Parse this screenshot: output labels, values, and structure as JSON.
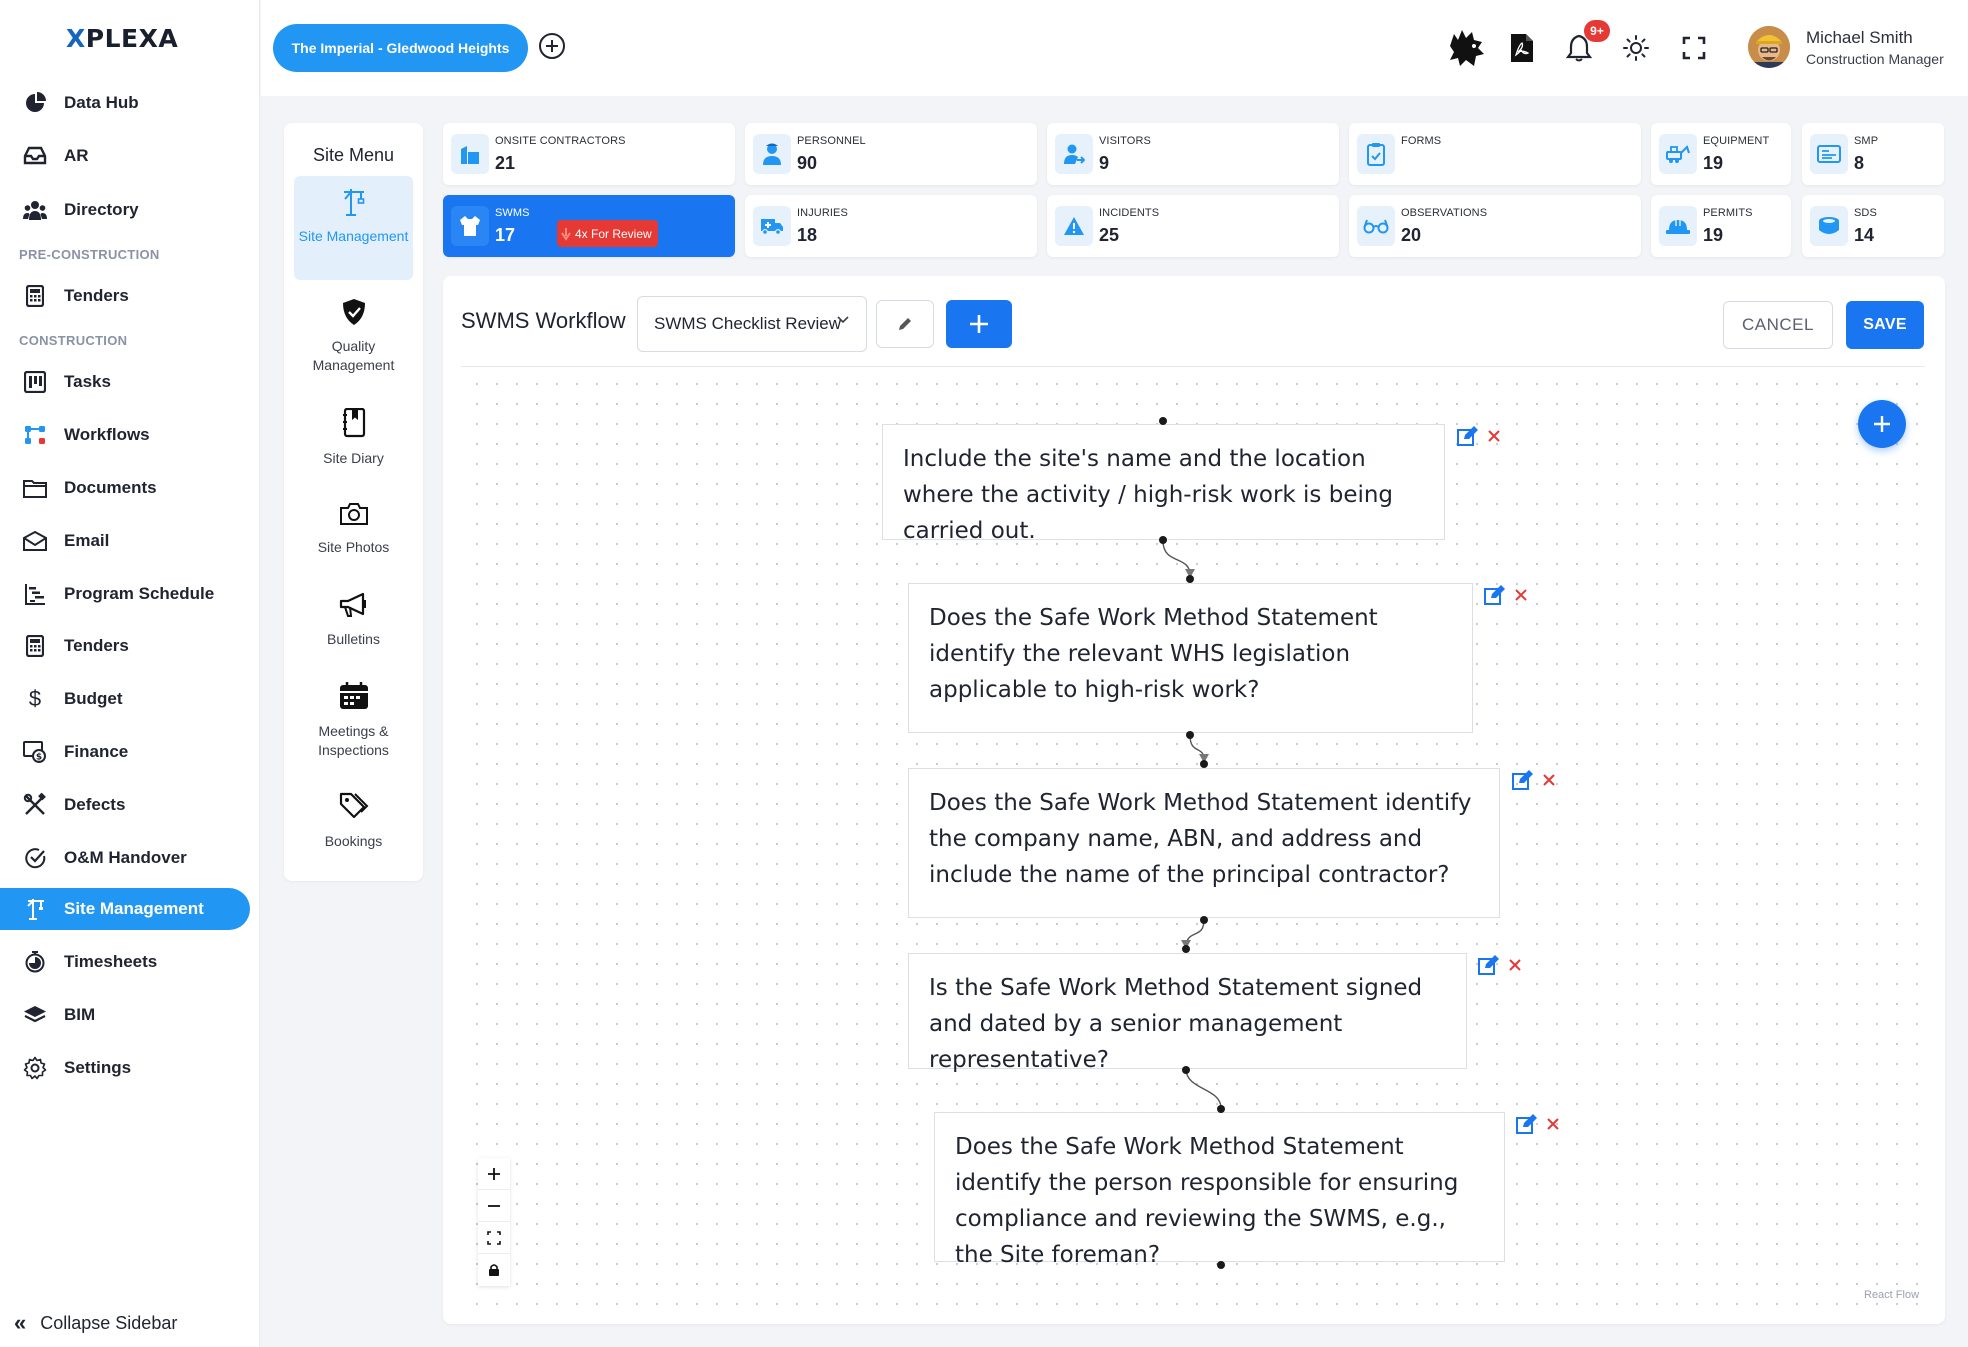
{
  "brand": {
    "logo_mark": "X",
    "logo_text": "PLEXA",
    "accent": "#2196f3",
    "primary": "#1976f0"
  },
  "sidebar": {
    "items_top": [
      {
        "label": "Data Hub",
        "icon": "pie-chart-icon"
      },
      {
        "label": "AR",
        "icon": "headset-icon"
      },
      {
        "label": "Directory",
        "icon": "people-icon"
      }
    ],
    "sections": {
      "pre_construction": "PRE-CONSTRUCTION",
      "construction": "CONSTRUCTION"
    },
    "pre_items": [
      {
        "label": "Tenders",
        "icon": "calculator-icon"
      }
    ],
    "items": [
      {
        "label": "Tasks",
        "icon": "kanban-icon"
      },
      {
        "label": "Workflows",
        "icon": "workflow-icon"
      },
      {
        "label": "Documents",
        "icon": "folder-icon"
      },
      {
        "label": "Email",
        "icon": "envelope-icon"
      },
      {
        "label": "Program Schedule",
        "icon": "gantt-icon"
      },
      {
        "label": "Tenders",
        "icon": "calculator-icon"
      },
      {
        "label": "Budget",
        "icon": "dollar-icon"
      },
      {
        "label": "Finance",
        "icon": "finance-icon"
      },
      {
        "label": "Defects",
        "icon": "tools-icon"
      },
      {
        "label": "O&M Handover",
        "icon": "check-circle-icon"
      },
      {
        "label": "Site Management",
        "icon": "crane-icon"
      },
      {
        "label": "Timesheets",
        "icon": "stopwatch-icon"
      },
      {
        "label": "BIM",
        "icon": "layers-icon"
      },
      {
        "label": "Settings",
        "icon": "gear-icon"
      }
    ],
    "collapse_label": "Collapse Sidebar"
  },
  "topbar": {
    "project": "The Imperial - Gledwood Heights",
    "notification_count": "9+",
    "user": {
      "name": "Michael Smith",
      "role": "Construction Manager"
    }
  },
  "site_menu": {
    "title": "Site Menu",
    "items": [
      {
        "label": "Site Management",
        "icon": "crane-icon"
      },
      {
        "label": "Quality Management",
        "icon": "shield-check-icon"
      },
      {
        "label": "Site Diary",
        "icon": "diary-icon"
      },
      {
        "label": "Site Photos",
        "icon": "camera-icon"
      },
      {
        "label": "Bulletins",
        "icon": "megaphone-icon"
      },
      {
        "label": "Meetings & Inspections",
        "icon": "calendar-icon"
      },
      {
        "label": "Bookings",
        "icon": "tags-icon"
      }
    ]
  },
  "stats": [
    {
      "label": "ONSITE CONTRACTORS",
      "value": "21",
      "icon": "building-icon"
    },
    {
      "label": "PERSONNEL",
      "value": "90",
      "icon": "worker-icon"
    },
    {
      "label": "VISITORS",
      "value": "9",
      "icon": "visitor-icon"
    },
    {
      "label": "FORMS",
      "value": "",
      "icon": "clipboard-icon"
    },
    {
      "label": "EQUIPMENT",
      "value": "19",
      "icon": "excavator-icon"
    },
    {
      "label": "SMP",
      "value": "8",
      "icon": "id-card-icon"
    },
    {
      "label": "SWMS",
      "value": "17",
      "icon": "vest-icon",
      "badge": "4x For Review"
    },
    {
      "label": "INJURIES",
      "value": "18",
      "icon": "ambulance-icon"
    },
    {
      "label": "INCIDENTS",
      "value": "25",
      "icon": "warning-icon"
    },
    {
      "label": "OBSERVATIONS",
      "value": "20",
      "icon": "glasses-icon"
    },
    {
      "label": "PERMITS",
      "value": "19",
      "icon": "hardhat-icon"
    },
    {
      "label": "SDS",
      "value": "14",
      "icon": "barrel-icon"
    }
  ],
  "workflow": {
    "title": "SWMS Workflow",
    "selected_checklist": "SWMS Checklist Review",
    "cancel_label": "CANCEL",
    "save_label": "SAVE",
    "nodes": [
      "Include the site's name and the location where the activity / high-risk work is being carried out.",
      "Does the Safe Work Method Statement identify the relevant WHS legislation applicable to high-risk work?",
      "Does the Safe Work Method Statement identify the company name, ABN, and address and include the name of the principal contractor?",
      "Is the Safe Work Method Statement signed and dated by a senior management representative?",
      "Does the Safe Work Method Statement identify the person responsible for ensuring compliance and reviewing the SWMS, e.g., the Site foreman?"
    ],
    "attribution": "React Flow"
  }
}
